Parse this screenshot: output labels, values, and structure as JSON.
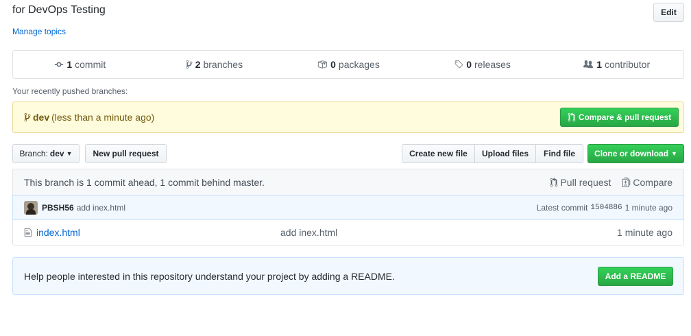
{
  "repo": {
    "description": "for DevOps Testing",
    "manage_topics": "Manage topics",
    "edit_label": "Edit"
  },
  "summary": {
    "commits_count": "1",
    "commits_label": "commit",
    "branches_count": "2",
    "branches_label": "branches",
    "packages_count": "0",
    "packages_label": "packages",
    "releases_count": "0",
    "releases_label": "releases",
    "contributors_count": "1",
    "contributors_label": "contributor"
  },
  "recent_push": {
    "label": "Your recently pushed branches:",
    "branch": "dev",
    "time": "(less than a minute ago)",
    "compare_label": "Compare & pull request"
  },
  "toolbar": {
    "branch_prefix": "Branch:",
    "branch_name": "dev",
    "new_pr_label": "New pull request",
    "create_file_label": "Create new file",
    "upload_label": "Upload files",
    "find_label": "Find file",
    "clone_label": "Clone or download"
  },
  "branch_status": {
    "text": "This branch is 1 commit ahead, 1 commit behind master.",
    "pull_request_label": "Pull request",
    "compare_label": "Compare"
  },
  "latest_commit": {
    "author": "PBSH56",
    "message": "add inex.html",
    "prefix": "Latest commit",
    "sha": "1504886",
    "age": "1 minute ago"
  },
  "files": [
    {
      "name": "index.html",
      "message": "add inex.html",
      "age": "1 minute ago"
    }
  ],
  "readme": {
    "text": "Help people interested in this repository understand your project by adding a README.",
    "button_label": "Add a README"
  },
  "colors": {
    "link": "#0366d6",
    "green": "#28a745",
    "notice_bg": "#fffbdd",
    "info_bg": "#f1f8ff"
  }
}
